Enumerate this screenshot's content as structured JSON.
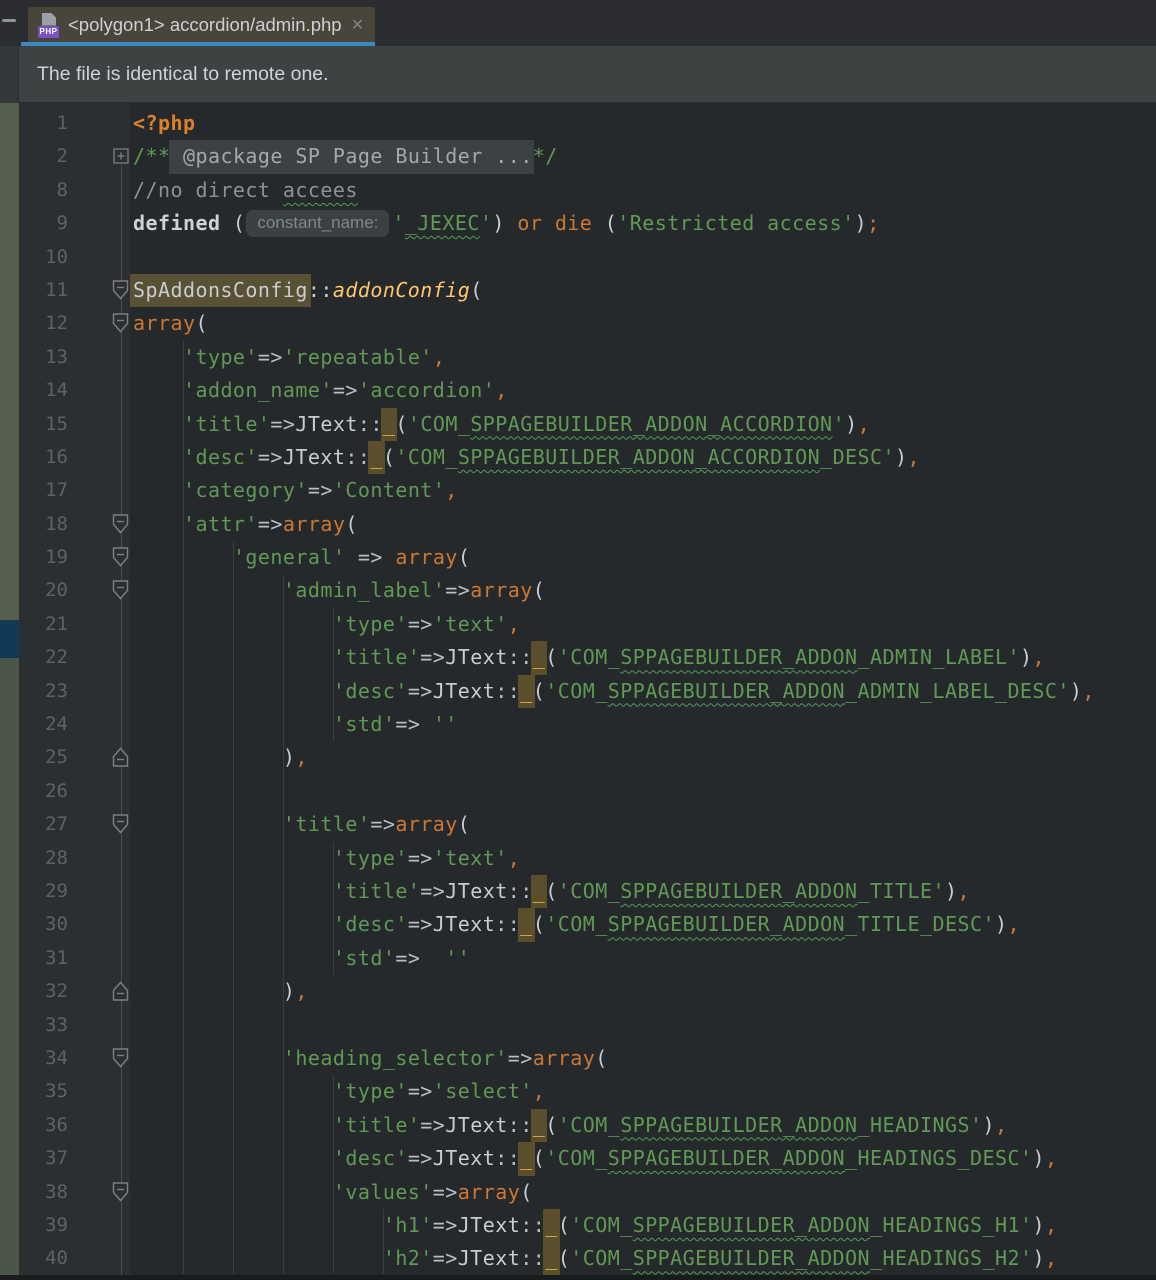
{
  "tab_bar": {
    "dash": "",
    "tab": {
      "icon": "php-file-icon",
      "title": "<polygon1> accordion/admin.php",
      "close_glyph": "×",
      "active": true
    }
  },
  "notification": {
    "message": "The file is identical to remote one."
  },
  "colors": {
    "tab_active_bg": "#4a453a",
    "tab_underline": "#3d87c2",
    "editor_bg": "#26292b",
    "gutter_bg": "#2c2f31",
    "left_strip_green": "#545f4d",
    "left_strip_selection_blue": "#113a57",
    "string_green": "#609955",
    "keyword_orange": "#cc7832",
    "method_yellow": "#ffc66d",
    "identifier_highlight": "#595134"
  },
  "editor": {
    "language": "php",
    "lines": [
      {
        "n": "1",
        "fold": null,
        "t": [
          [
            "php",
            "<?php"
          ]
        ]
      },
      {
        "n": "2",
        "fold": "p",
        "t": [
          [
            "doc",
            "/**"
          ],
          [
            "fold-text",
            " @package SP Page Builder ..."
          ],
          [
            "doc",
            "*/"
          ]
        ]
      },
      {
        "n": "8",
        "fold": null,
        "t": [
          [
            "cm",
            "//no direct "
          ],
          [
            "cme",
            "accees"
          ]
        ]
      },
      {
        "n": "9",
        "fold": null,
        "t": [
          [
            "def",
            "defined"
          ],
          [
            "pl",
            " ("
          ],
          [
            "hint",
            "constant_name:"
          ],
          [
            "st",
            "'"
          ],
          [
            "ste",
            "_JEXEC"
          ],
          [
            "st",
            "'"
          ],
          [
            "pl",
            ") "
          ],
          [
            "kw",
            "or"
          ],
          [
            "pl",
            " "
          ],
          [
            "kw",
            "die"
          ],
          [
            "pl",
            " ("
          ],
          [
            "st",
            "'Restricted access'"
          ],
          [
            "pl",
            ")"
          ],
          [
            "kw",
            ";"
          ]
        ]
      },
      {
        "n": "10",
        "fold": null,
        "t": []
      },
      {
        "n": "11",
        "fold": "d",
        "t": [
          [
            "hlid",
            "SpAddonsConfig"
          ],
          [
            "pl",
            "::"
          ],
          [
            "mth",
            "addonConfig"
          ],
          [
            "pl",
            "("
          ]
        ]
      },
      {
        "n": "12",
        "fold": "d",
        "t": [
          [
            "kw",
            "array"
          ],
          [
            "pl",
            "("
          ]
        ]
      },
      {
        "n": "13",
        "fold": null,
        "t": [
          [
            "pl",
            "    "
          ],
          [
            "st",
            "'type'"
          ],
          [
            "op",
            "=>"
          ],
          [
            "st",
            "'repeatable'"
          ],
          [
            "kw",
            ","
          ]
        ]
      },
      {
        "n": "14",
        "fold": null,
        "t": [
          [
            "pl",
            "    "
          ],
          [
            "st",
            "'addon_name'"
          ],
          [
            "op",
            "=>"
          ],
          [
            "st",
            "'accordion'"
          ],
          [
            "kw",
            ","
          ]
        ]
      },
      {
        "n": "15",
        "fold": null,
        "t": [
          [
            "pl",
            "    "
          ],
          [
            "st",
            "'title'"
          ],
          [
            "op",
            "=>"
          ],
          [
            "pl",
            "JText"
          ],
          [
            "op",
            "::"
          ],
          [
            "hl",
            "_"
          ],
          [
            "pl",
            "("
          ],
          [
            "st",
            "'COM_"
          ],
          [
            "ste",
            "SPPAGEBUILDER_ADDON_ACCORDION"
          ],
          [
            "st",
            "'"
          ],
          [
            "pl",
            ")"
          ],
          [
            "kw",
            ","
          ]
        ]
      },
      {
        "n": "16",
        "fold": null,
        "t": [
          [
            "pl",
            "    "
          ],
          [
            "st",
            "'desc'"
          ],
          [
            "op",
            "=>"
          ],
          [
            "pl",
            "JText"
          ],
          [
            "op",
            "::"
          ],
          [
            "hl",
            "_"
          ],
          [
            "pl",
            "("
          ],
          [
            "st",
            "'COM_"
          ],
          [
            "ste",
            "SPPAGEBUILDER_ADDON_ACCORDION"
          ],
          [
            "st",
            "_DESC'"
          ],
          [
            "pl",
            ")"
          ],
          [
            "kw",
            ","
          ]
        ]
      },
      {
        "n": "17",
        "fold": null,
        "t": [
          [
            "pl",
            "    "
          ],
          [
            "st",
            "'category'"
          ],
          [
            "op",
            "=>"
          ],
          [
            "st",
            "'Content'"
          ],
          [
            "kw",
            ","
          ]
        ]
      },
      {
        "n": "18",
        "fold": "d",
        "t": [
          [
            "pl",
            "    "
          ],
          [
            "st",
            "'attr'"
          ],
          [
            "op",
            "=>"
          ],
          [
            "kw",
            "array"
          ],
          [
            "pl",
            "("
          ]
        ]
      },
      {
        "n": "19",
        "fold": "d",
        "t": [
          [
            "pl",
            "        "
          ],
          [
            "st",
            "'general'"
          ],
          [
            "pl",
            " "
          ],
          [
            "op",
            "=>"
          ],
          [
            "pl",
            " "
          ],
          [
            "kw",
            "array"
          ],
          [
            "pl",
            "("
          ]
        ]
      },
      {
        "n": "20",
        "fold": "d",
        "t": [
          [
            "pl",
            "            "
          ],
          [
            "st",
            "'admin_label'"
          ],
          [
            "op",
            "=>"
          ],
          [
            "kw",
            "array"
          ],
          [
            "pl",
            "("
          ]
        ]
      },
      {
        "n": "21",
        "fold": null,
        "t": [
          [
            "pl",
            "                "
          ],
          [
            "st",
            "'type'"
          ],
          [
            "op",
            "=>"
          ],
          [
            "st",
            "'text'"
          ],
          [
            "kw",
            ","
          ]
        ]
      },
      {
        "n": "22",
        "fold": null,
        "t": [
          [
            "pl",
            "                "
          ],
          [
            "st",
            "'title'"
          ],
          [
            "op",
            "=>"
          ],
          [
            "pl",
            "JText"
          ],
          [
            "op",
            "::"
          ],
          [
            "hl",
            "_"
          ],
          [
            "pl",
            "("
          ],
          [
            "st",
            "'COM_"
          ],
          [
            "ste",
            "SPPAGEBUILDER_ADDON"
          ],
          [
            "st",
            "_ADMIN_LABEL'"
          ],
          [
            "pl",
            ")"
          ],
          [
            "kw",
            ","
          ]
        ]
      },
      {
        "n": "23",
        "fold": null,
        "t": [
          [
            "pl",
            "                "
          ],
          [
            "st",
            "'desc'"
          ],
          [
            "op",
            "=>"
          ],
          [
            "pl",
            "JText"
          ],
          [
            "op",
            "::"
          ],
          [
            "hl",
            "_"
          ],
          [
            "pl",
            "("
          ],
          [
            "st",
            "'COM_"
          ],
          [
            "ste",
            "SPPAGEBUILDER_ADDON"
          ],
          [
            "st",
            "_ADMIN_LABEL_DESC'"
          ],
          [
            "pl",
            ")"
          ],
          [
            "kw",
            ","
          ]
        ]
      },
      {
        "n": "24",
        "fold": null,
        "t": [
          [
            "pl",
            "                "
          ],
          [
            "st",
            "'std'"
          ],
          [
            "op",
            "=>"
          ],
          [
            "pl",
            " "
          ],
          [
            "st",
            "''"
          ]
        ]
      },
      {
        "n": "25",
        "fold": "u",
        "t": [
          [
            "pl",
            "            )"
          ],
          [
            "kw",
            ","
          ]
        ]
      },
      {
        "n": "26",
        "fold": null,
        "t": []
      },
      {
        "n": "27",
        "fold": "d",
        "t": [
          [
            "pl",
            "            "
          ],
          [
            "st",
            "'title'"
          ],
          [
            "op",
            "=>"
          ],
          [
            "kw",
            "array"
          ],
          [
            "pl",
            "("
          ]
        ]
      },
      {
        "n": "28",
        "fold": null,
        "t": [
          [
            "pl",
            "                "
          ],
          [
            "st",
            "'type'"
          ],
          [
            "op",
            "=>"
          ],
          [
            "st",
            "'text'"
          ],
          [
            "kw",
            ","
          ]
        ]
      },
      {
        "n": "29",
        "fold": null,
        "t": [
          [
            "pl",
            "                "
          ],
          [
            "st",
            "'title'"
          ],
          [
            "op",
            "=>"
          ],
          [
            "pl",
            "JText"
          ],
          [
            "op",
            "::"
          ],
          [
            "hl",
            "_"
          ],
          [
            "pl",
            "("
          ],
          [
            "st",
            "'COM_"
          ],
          [
            "ste",
            "SPPAGEBUILDER_ADDON"
          ],
          [
            "st",
            "_TITLE'"
          ],
          [
            "pl",
            ")"
          ],
          [
            "kw",
            ","
          ]
        ]
      },
      {
        "n": "30",
        "fold": null,
        "t": [
          [
            "pl",
            "                "
          ],
          [
            "st",
            "'desc'"
          ],
          [
            "op",
            "=>"
          ],
          [
            "pl",
            "JText"
          ],
          [
            "op",
            "::"
          ],
          [
            "hl",
            "_"
          ],
          [
            "pl",
            "("
          ],
          [
            "st",
            "'COM_"
          ],
          [
            "ste",
            "SPPAGEBUILDER_ADDON"
          ],
          [
            "st",
            "_TITLE_DESC'"
          ],
          [
            "pl",
            ")"
          ],
          [
            "kw",
            ","
          ]
        ]
      },
      {
        "n": "31",
        "fold": null,
        "t": [
          [
            "pl",
            "                "
          ],
          [
            "st",
            "'std'"
          ],
          [
            "op",
            "=>"
          ],
          [
            "pl",
            "  "
          ],
          [
            "st",
            "''"
          ]
        ]
      },
      {
        "n": "32",
        "fold": "u",
        "t": [
          [
            "pl",
            "            )"
          ],
          [
            "kw",
            ","
          ]
        ]
      },
      {
        "n": "33",
        "fold": null,
        "t": []
      },
      {
        "n": "34",
        "fold": "d",
        "t": [
          [
            "pl",
            "            "
          ],
          [
            "st",
            "'heading_selector'"
          ],
          [
            "op",
            "=>"
          ],
          [
            "kw",
            "array"
          ],
          [
            "pl",
            "("
          ]
        ]
      },
      {
        "n": "35",
        "fold": null,
        "t": [
          [
            "pl",
            "                "
          ],
          [
            "st",
            "'type'"
          ],
          [
            "op",
            "=>"
          ],
          [
            "st",
            "'select'"
          ],
          [
            "kw",
            ","
          ]
        ]
      },
      {
        "n": "36",
        "fold": null,
        "t": [
          [
            "pl",
            "                "
          ],
          [
            "st",
            "'title'"
          ],
          [
            "op",
            "=>"
          ],
          [
            "pl",
            "JText"
          ],
          [
            "op",
            "::"
          ],
          [
            "hl",
            "_"
          ],
          [
            "pl",
            "("
          ],
          [
            "st",
            "'COM_"
          ],
          [
            "ste",
            "SPPAGEBUILDER_ADDON"
          ],
          [
            "st",
            "_HEADINGS'"
          ],
          [
            "pl",
            ")"
          ],
          [
            "kw",
            ","
          ]
        ]
      },
      {
        "n": "37",
        "fold": null,
        "t": [
          [
            "pl",
            "                "
          ],
          [
            "st",
            "'desc'"
          ],
          [
            "op",
            "=>"
          ],
          [
            "pl",
            "JText"
          ],
          [
            "op",
            "::"
          ],
          [
            "hl",
            "_"
          ],
          [
            "pl",
            "("
          ],
          [
            "st",
            "'COM_"
          ],
          [
            "ste",
            "SPPAGEBUILDER_ADDON"
          ],
          [
            "st",
            "_HEADINGS_DESC'"
          ],
          [
            "pl",
            ")"
          ],
          [
            "kw",
            ","
          ]
        ]
      },
      {
        "n": "38",
        "fold": "d",
        "t": [
          [
            "pl",
            "                "
          ],
          [
            "st",
            "'values'"
          ],
          [
            "op",
            "=>"
          ],
          [
            "kw",
            "array"
          ],
          [
            "pl",
            "("
          ]
        ]
      },
      {
        "n": "39",
        "fold": null,
        "t": [
          [
            "pl",
            "                    "
          ],
          [
            "st",
            "'h1'"
          ],
          [
            "op",
            "=>"
          ],
          [
            "pl",
            "JText"
          ],
          [
            "op",
            "::"
          ],
          [
            "hl",
            "_"
          ],
          [
            "pl",
            "("
          ],
          [
            "st",
            "'COM_"
          ],
          [
            "ste",
            "SPPAGEBUILDER_ADDON"
          ],
          [
            "st",
            "_HEADINGS_H1'"
          ],
          [
            "pl",
            ")"
          ],
          [
            "kw",
            ","
          ]
        ]
      },
      {
        "n": "40",
        "fold": null,
        "t": [
          [
            "pl",
            "                    "
          ],
          [
            "st",
            "'h2'"
          ],
          [
            "op",
            "=>"
          ],
          [
            "pl",
            "JText"
          ],
          [
            "op",
            "::"
          ],
          [
            "hl",
            "_"
          ],
          [
            "pl",
            "("
          ],
          [
            "st",
            "'COM_"
          ],
          [
            "ste",
            "SPPAGEBUILDER_ADDON"
          ],
          [
            "st",
            "_HEADINGS_H2'"
          ],
          [
            "pl",
            ")"
          ],
          [
            "kw",
            ","
          ]
        ]
      }
    ]
  }
}
